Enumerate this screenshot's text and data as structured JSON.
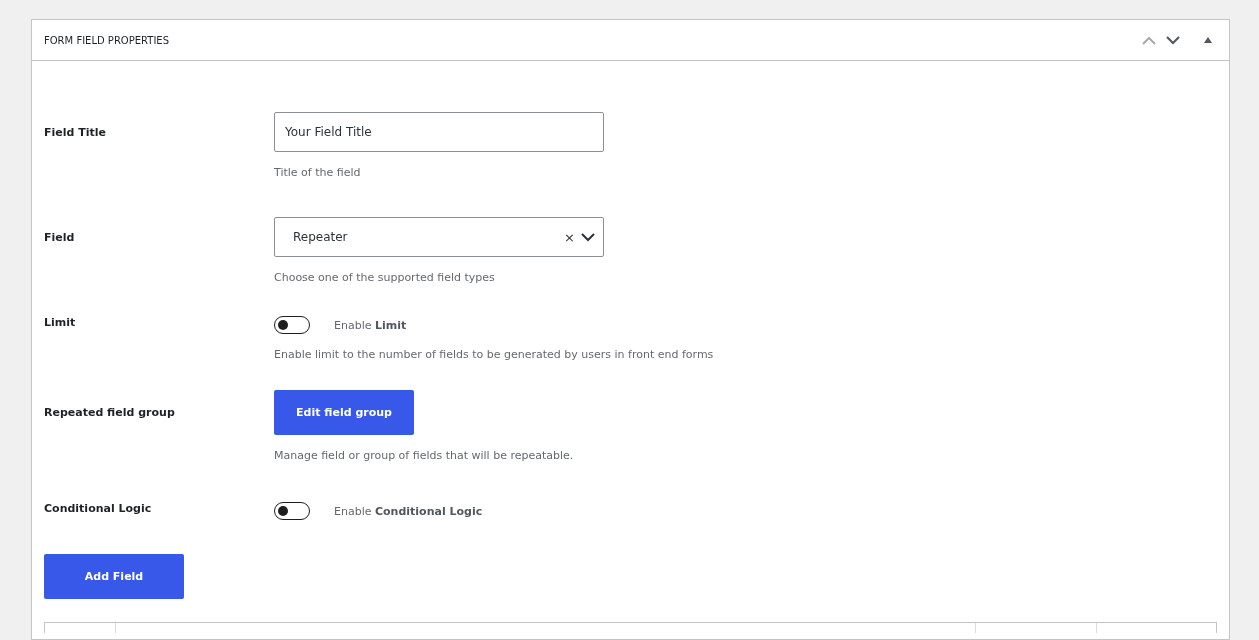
{
  "panel": {
    "title": "FORM FIELD PROPERTIES",
    "expanded": true
  },
  "rows": [
    {
      "kind": "text",
      "label": "Field Title",
      "value": "Your Field Title",
      "help": "Title of the field"
    },
    {
      "kind": "select",
      "label": "Field",
      "value": "Repeater",
      "clear": "×",
      "help": "Choose one of the supported field types"
    },
    {
      "kind": "toggle",
      "label": "Limit",
      "on": false,
      "text": "Enable **Limit**",
      "help": "Enable limit to the number of fields to be generated by users in front end forms"
    },
    {
      "kind": "button",
      "label": "Repeated field group",
      "button": "Edit field group",
      "help": "Manage field or group of fields that will be repeatable."
    },
    {
      "kind": "toggle",
      "label": "Conditional Logic",
      "on": false,
      "text": "Enable **Conditional Logic**"
    }
  ],
  "add_button": "Add Field"
}
